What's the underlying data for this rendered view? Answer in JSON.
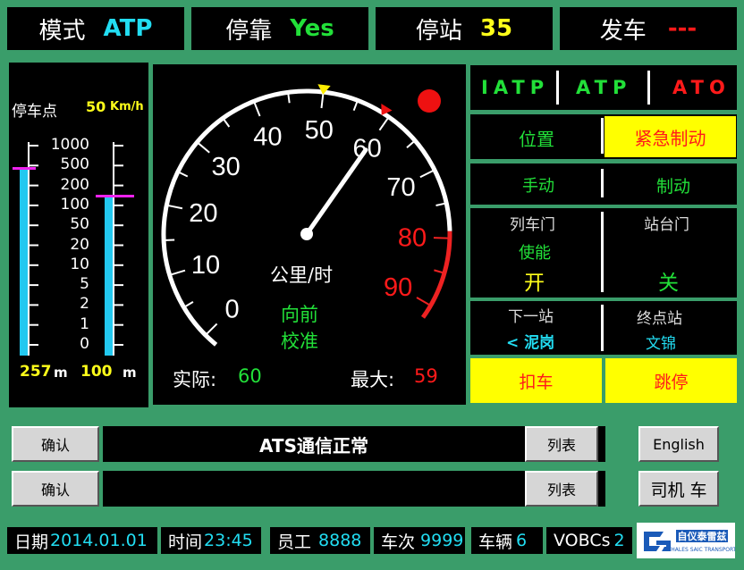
{
  "top": {
    "mode_label": "模式",
    "mode_value": "ATP",
    "dock_label": "停靠",
    "dock_value": "Yes",
    "stop_label": "停站",
    "stop_value": "35",
    "depart_label": "发车",
    "depart_value": "---"
  },
  "left": {
    "stop_point_label": "停车点",
    "speed_value": "50",
    "speed_unit": "Km/h",
    "scale": [
      "1000",
      "500",
      "200",
      "100",
      "50",
      "20",
      "10",
      "5",
      "2",
      "1",
      "0"
    ],
    "dist_left": "257",
    "dist_left_unit": "m",
    "dist_right": "100",
    "dist_right_unit": "m",
    "bar_left_fraction": 0.88,
    "bar_right_fraction": 0.75
  },
  "speedo": {
    "ticks": [
      "0",
      "10",
      "20",
      "30",
      "40",
      "50",
      "60",
      "70",
      "80",
      "90"
    ],
    "unit": "公里/时",
    "direction": "向前",
    "calibrate": "校准",
    "actual_label": "实际:",
    "actual_value": "60",
    "max_label": "最大:",
    "max_value": "59",
    "needle_speed": 60
  },
  "right": {
    "modes": [
      "IATP",
      "ATP",
      "ATO"
    ],
    "position": "位置",
    "emergency_brake": "紧急制动",
    "manual": "手动",
    "brake": "制动",
    "train_door": "列车门",
    "platform_door": "站台门",
    "enable": "使能",
    "open": "开",
    "close": "关",
    "next_station_label": "下一站",
    "terminal_label": "终点站",
    "next_station": "< 泥岗",
    "terminal": "文锦",
    "hold": "扣车",
    "skip": "跳停"
  },
  "messages": {
    "row1": {
      "confirm": "确认",
      "text": "ATS通信正常",
      "list": "列表"
    },
    "row2": {
      "confirm": "确认",
      "text": "",
      "list": "列表"
    }
  },
  "side_buttons": {
    "english": "English",
    "driver": "司机 车"
  },
  "status": {
    "date_label": "日期",
    "date": "2014.01.01",
    "time_label": "时间",
    "time": "23:45",
    "staff_label": "员工",
    "staff": "8888",
    "train_label": "车次",
    "train": "9999",
    "vehicle_label": "车辆",
    "vehicle": "6",
    "vobcs_label": "VOBCs",
    "vobcs": "2"
  },
  "colors": {
    "bg": "#3a9d6a",
    "cyan": "#22ddf2",
    "green": "#22e039",
    "yellow": "#ffff1a",
    "red": "#ff1a1a"
  }
}
